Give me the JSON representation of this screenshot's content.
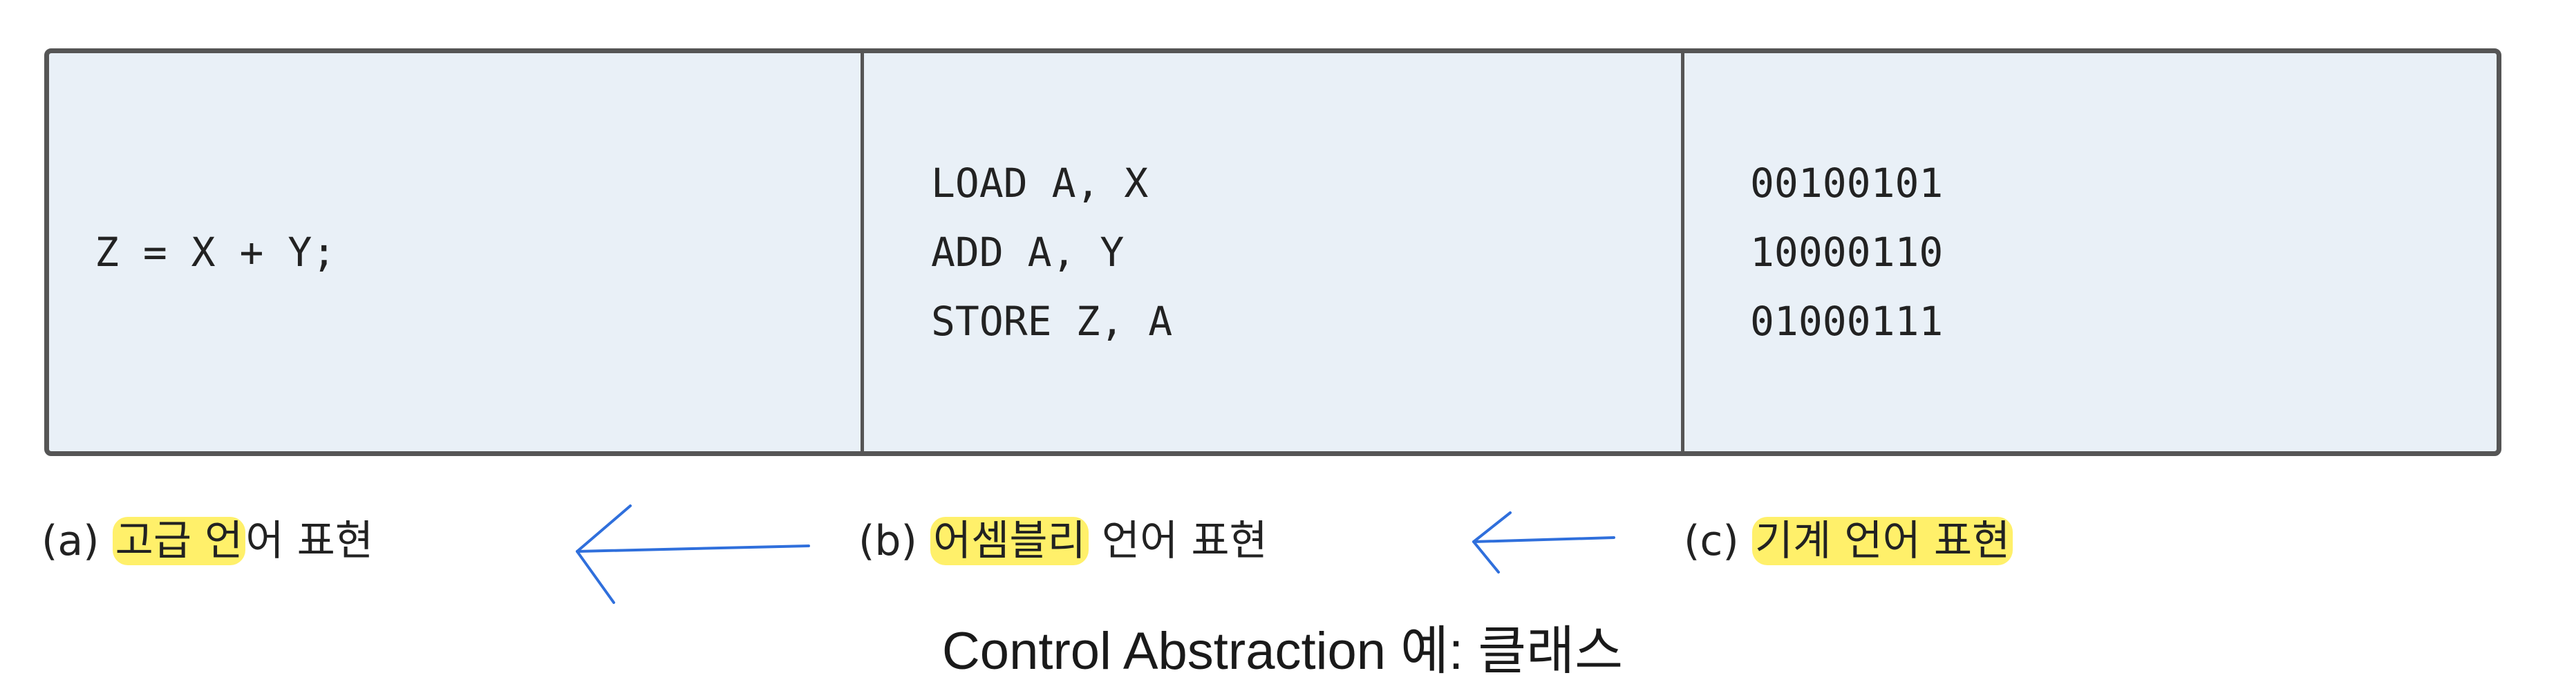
{
  "table": {
    "high_level": [
      "Z = X + Y;"
    ],
    "assembly": [
      "LOAD A, X",
      "ADD A, Y",
      "STORE Z, A"
    ],
    "machine": [
      "00100101",
      "10000110",
      "01000111"
    ]
  },
  "captions": {
    "a": {
      "prefix": "(a) ",
      "highlight": "고급 언",
      "rest": "어 표현"
    },
    "b": {
      "prefix": "(b) ",
      "highlight": "어셈블리",
      "rest": " 언어 표현"
    },
    "c": {
      "prefix": "(c) ",
      "highlight": "기계 언어 표현",
      "rest": ""
    }
  },
  "footer": {
    "title": "Control Abstraction 예: 클래스"
  },
  "colors": {
    "cell_background": "#e9f0f7",
    "border": "#555555",
    "highlight": "#fff06a",
    "arrow": "#2f6fdc"
  }
}
